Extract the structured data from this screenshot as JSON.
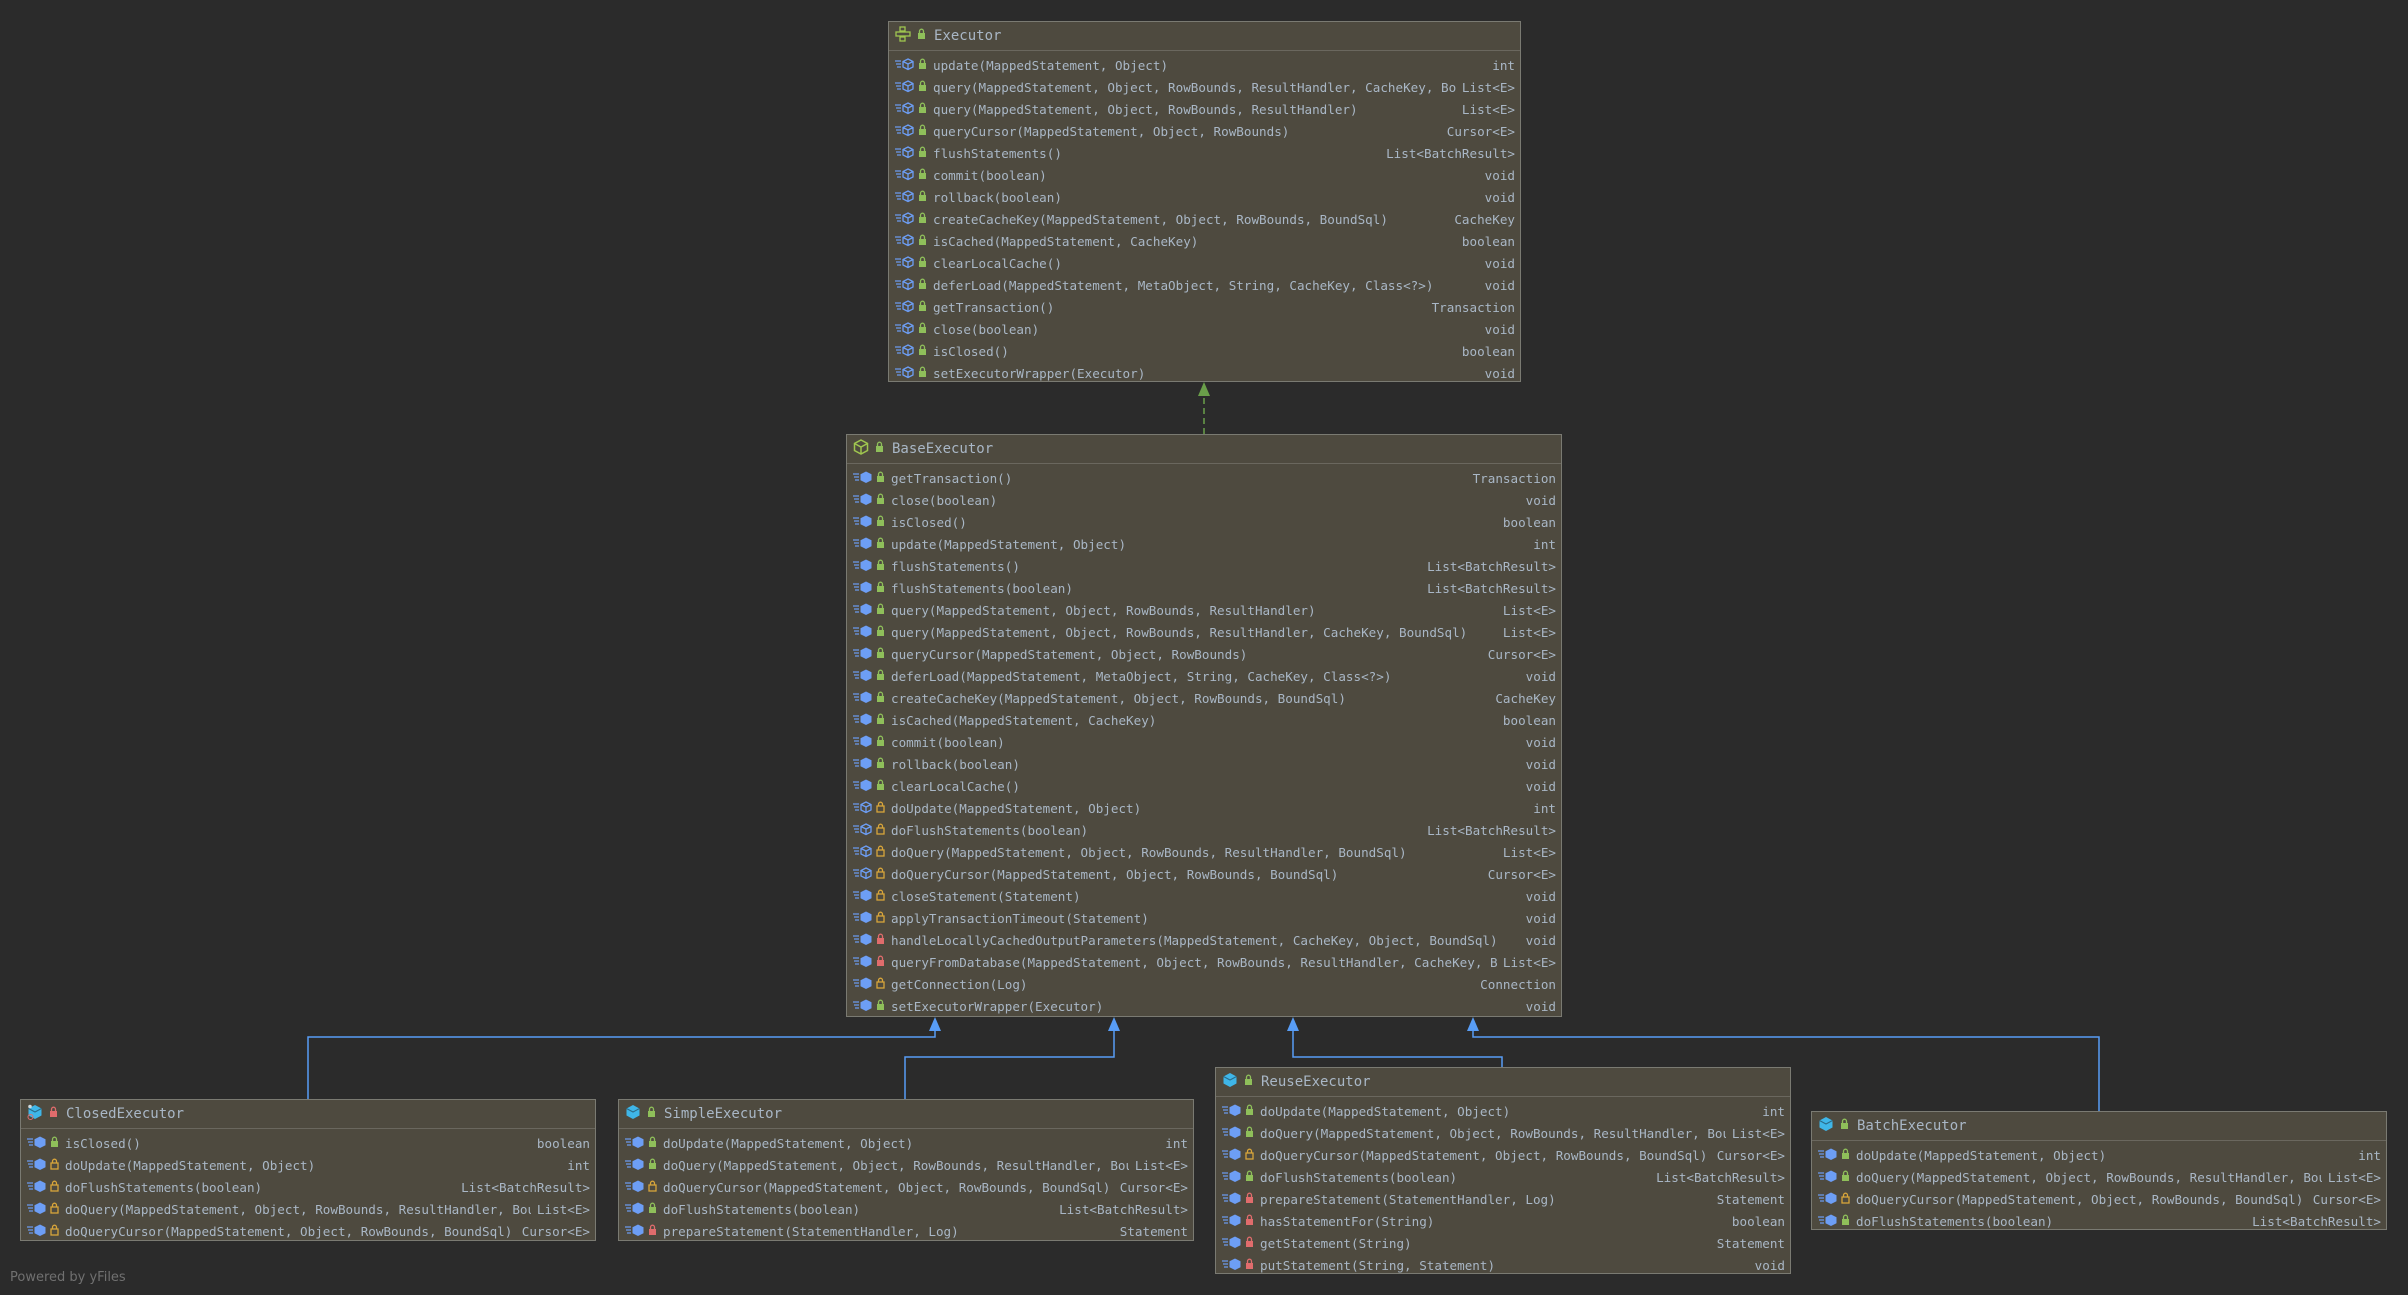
{
  "colors": {
    "background": "#2b2b2b",
    "box_fill": "#4e4a3f",
    "text": "#a9b7c6",
    "public_lock": "#8fbf5a",
    "protected_lock": "#d8a53a",
    "private_lock": "#e06c6c",
    "method_icon": "#6d9ef5",
    "class_icon": "#3fb6e8",
    "interface_icon": "#9fc54f",
    "implements_edge": "#6a9f4a",
    "extends_edge": "#589df6"
  },
  "classes": {
    "executor": {
      "name": "Executor",
      "kind": "interface",
      "visibility": "public",
      "methods": [
        {
          "sig": "update(MappedStatement, Object)",
          "ret": "int",
          "vis": "public",
          "abstract": true
        },
        {
          "sig": "query(MappedStatement, Object, RowBounds, ResultHandler, CacheKey, BoundSql)",
          "ret": "List<E>",
          "vis": "public",
          "abstract": true
        },
        {
          "sig": "query(MappedStatement, Object, RowBounds, ResultHandler)",
          "ret": "List<E>",
          "vis": "public",
          "abstract": true
        },
        {
          "sig": "queryCursor(MappedStatement, Object, RowBounds)",
          "ret": "Cursor<E>",
          "vis": "public",
          "abstract": true
        },
        {
          "sig": "flushStatements()",
          "ret": "List<BatchResult>",
          "vis": "public",
          "abstract": true
        },
        {
          "sig": "commit(boolean)",
          "ret": "void",
          "vis": "public",
          "abstract": true
        },
        {
          "sig": "rollback(boolean)",
          "ret": "void",
          "vis": "public",
          "abstract": true
        },
        {
          "sig": "createCacheKey(MappedStatement, Object, RowBounds, BoundSql)",
          "ret": "CacheKey",
          "vis": "public",
          "abstract": true
        },
        {
          "sig": "isCached(MappedStatement, CacheKey)",
          "ret": "boolean",
          "vis": "public",
          "abstract": true
        },
        {
          "sig": "clearLocalCache()",
          "ret": "void",
          "vis": "public",
          "abstract": true
        },
        {
          "sig": "deferLoad(MappedStatement, MetaObject, String, CacheKey, Class<?>)",
          "ret": "void",
          "vis": "public",
          "abstract": true
        },
        {
          "sig": "getTransaction()",
          "ret": "Transaction",
          "vis": "public",
          "abstract": true
        },
        {
          "sig": "close(boolean)",
          "ret": "void",
          "vis": "public",
          "abstract": true
        },
        {
          "sig": "isClosed()",
          "ret": "boolean",
          "vis": "public",
          "abstract": true
        },
        {
          "sig": "setExecutorWrapper(Executor)",
          "ret": "void",
          "vis": "public",
          "abstract": true
        }
      ]
    },
    "base": {
      "name": "BaseExecutor",
      "kind": "abstract-class",
      "visibility": "public",
      "methods": [
        {
          "sig": "getTransaction()",
          "ret": "Transaction",
          "vis": "public",
          "abstract": false
        },
        {
          "sig": "close(boolean)",
          "ret": "void",
          "vis": "public",
          "abstract": false
        },
        {
          "sig": "isClosed()",
          "ret": "boolean",
          "vis": "public",
          "abstract": false
        },
        {
          "sig": "update(MappedStatement, Object)",
          "ret": "int",
          "vis": "public",
          "abstract": false
        },
        {
          "sig": "flushStatements()",
          "ret": "List<BatchResult>",
          "vis": "public",
          "abstract": false
        },
        {
          "sig": "flushStatements(boolean)",
          "ret": "List<BatchResult>",
          "vis": "public",
          "abstract": false
        },
        {
          "sig": "query(MappedStatement, Object, RowBounds, ResultHandler)",
          "ret": "List<E>",
          "vis": "public",
          "abstract": false
        },
        {
          "sig": "query(MappedStatement, Object, RowBounds, ResultHandler, CacheKey, BoundSql)",
          "ret": "List<E>",
          "vis": "public",
          "abstract": false
        },
        {
          "sig": "queryCursor(MappedStatement, Object, RowBounds)",
          "ret": "Cursor<E>",
          "vis": "public",
          "abstract": false
        },
        {
          "sig": "deferLoad(MappedStatement, MetaObject, String, CacheKey, Class<?>)",
          "ret": "void",
          "vis": "public",
          "abstract": false
        },
        {
          "sig": "createCacheKey(MappedStatement, Object, RowBounds, BoundSql)",
          "ret": "CacheKey",
          "vis": "public",
          "abstract": false
        },
        {
          "sig": "isCached(MappedStatement, CacheKey)",
          "ret": "boolean",
          "vis": "public",
          "abstract": false
        },
        {
          "sig": "commit(boolean)",
          "ret": "void",
          "vis": "public",
          "abstract": false
        },
        {
          "sig": "rollback(boolean)",
          "ret": "void",
          "vis": "public",
          "abstract": false
        },
        {
          "sig": "clearLocalCache()",
          "ret": "void",
          "vis": "public",
          "abstract": false
        },
        {
          "sig": "doUpdate(MappedStatement, Object)",
          "ret": "int",
          "vis": "protected",
          "abstract": true
        },
        {
          "sig": "doFlushStatements(boolean)",
          "ret": "List<BatchResult>",
          "vis": "protected",
          "abstract": true
        },
        {
          "sig": "doQuery(MappedStatement, Object, RowBounds, ResultHandler, BoundSql)",
          "ret": "List<E>",
          "vis": "protected",
          "abstract": true
        },
        {
          "sig": "doQueryCursor(MappedStatement, Object, RowBounds, BoundSql)",
          "ret": "Cursor<E>",
          "vis": "protected",
          "abstract": true
        },
        {
          "sig": "closeStatement(Statement)",
          "ret": "void",
          "vis": "protected",
          "abstract": false
        },
        {
          "sig": "applyTransactionTimeout(Statement)",
          "ret": "void",
          "vis": "protected",
          "abstract": false
        },
        {
          "sig": "handleLocallyCachedOutputParameters(MappedStatement, CacheKey, Object, BoundSql)",
          "ret": "void",
          "vis": "private",
          "abstract": false
        },
        {
          "sig": "queryFromDatabase(MappedStatement, Object, RowBounds, ResultHandler, CacheKey, BoundSql)",
          "ret": "List<E>",
          "vis": "private",
          "abstract": false
        },
        {
          "sig": "getConnection(Log)",
          "ret": "Connection",
          "vis": "protected",
          "abstract": false
        },
        {
          "sig": "setExecutorWrapper(Executor)",
          "ret": "void",
          "vis": "public",
          "abstract": false
        }
      ]
    },
    "closed": {
      "name": "ClosedExecutor",
      "kind": "inner-class",
      "visibility": "private",
      "methods": [
        {
          "sig": "isClosed()",
          "ret": "boolean",
          "vis": "public",
          "abstract": false
        },
        {
          "sig": "doUpdate(MappedStatement, Object)",
          "ret": "int",
          "vis": "protected",
          "abstract": false
        },
        {
          "sig": "doFlushStatements(boolean)",
          "ret": "List<BatchResult>",
          "vis": "protected",
          "abstract": false
        },
        {
          "sig": "doQuery(MappedStatement, Object, RowBounds, ResultHandler, BoundSql)",
          "ret": "List<E>",
          "vis": "protected",
          "abstract": false
        },
        {
          "sig": "doQueryCursor(MappedStatement, Object, RowBounds, BoundSql)",
          "ret": "Cursor<E>",
          "vis": "protected",
          "abstract": false
        }
      ]
    },
    "simple": {
      "name": "SimpleExecutor",
      "kind": "class",
      "visibility": "public",
      "methods": [
        {
          "sig": "doUpdate(MappedStatement, Object)",
          "ret": "int",
          "vis": "public",
          "abstract": false
        },
        {
          "sig": "doQuery(MappedStatement, Object, RowBounds, ResultHandler, BoundSql)",
          "ret": "List<E>",
          "vis": "public",
          "abstract": false
        },
        {
          "sig": "doQueryCursor(MappedStatement, Object, RowBounds, BoundSql)",
          "ret": "Cursor<E>",
          "vis": "protected",
          "abstract": false
        },
        {
          "sig": "doFlushStatements(boolean)",
          "ret": "List<BatchResult>",
          "vis": "public",
          "abstract": false
        },
        {
          "sig": "prepareStatement(StatementHandler, Log)",
          "ret": "Statement",
          "vis": "private",
          "abstract": false
        }
      ]
    },
    "reuse": {
      "name": "ReuseExecutor",
      "kind": "class",
      "visibility": "public",
      "methods": [
        {
          "sig": "doUpdate(MappedStatement, Object)",
          "ret": "int",
          "vis": "public",
          "abstract": false
        },
        {
          "sig": "doQuery(MappedStatement, Object, RowBounds, ResultHandler, BoundSql)",
          "ret": "List<E>",
          "vis": "public",
          "abstract": false
        },
        {
          "sig": "doQueryCursor(MappedStatement, Object, RowBounds, BoundSql)",
          "ret": "Cursor<E>",
          "vis": "protected",
          "abstract": false
        },
        {
          "sig": "doFlushStatements(boolean)",
          "ret": "List<BatchResult>",
          "vis": "public",
          "abstract": false
        },
        {
          "sig": "prepareStatement(StatementHandler, Log)",
          "ret": "Statement",
          "vis": "private",
          "abstract": false
        },
        {
          "sig": "hasStatementFor(String)",
          "ret": "boolean",
          "vis": "private",
          "abstract": false
        },
        {
          "sig": "getStatement(String)",
          "ret": "Statement",
          "vis": "private",
          "abstract": false
        },
        {
          "sig": "putStatement(String, Statement)",
          "ret": "void",
          "vis": "private",
          "abstract": false
        }
      ]
    },
    "batch": {
      "name": "BatchExecutor",
      "kind": "class",
      "visibility": "public",
      "methods": [
        {
          "sig": "doUpdate(MappedStatement, Object)",
          "ret": "int",
          "vis": "public",
          "abstract": false
        },
        {
          "sig": "doQuery(MappedStatement, Object, RowBounds, ResultHandler, BoundSql)",
          "ret": "List<E>",
          "vis": "public",
          "abstract": false
        },
        {
          "sig": "doQueryCursor(MappedStatement, Object, RowBounds, BoundSql)",
          "ret": "Cursor<E>",
          "vis": "protected",
          "abstract": false
        },
        {
          "sig": "doFlushStatements(boolean)",
          "ret": "List<BatchResult>",
          "vis": "public",
          "abstract": false
        }
      ]
    }
  },
  "relations": [
    {
      "from": "BaseExecutor",
      "to": "Executor",
      "type": "implements"
    },
    {
      "from": "ClosedExecutor",
      "to": "BaseExecutor",
      "type": "extends"
    },
    {
      "from": "SimpleExecutor",
      "to": "BaseExecutor",
      "type": "extends"
    },
    {
      "from": "ReuseExecutor",
      "to": "BaseExecutor",
      "type": "extends"
    },
    {
      "from": "BatchExecutor",
      "to": "BaseExecutor",
      "type": "extends"
    }
  ],
  "footer": "Powered by yFiles"
}
